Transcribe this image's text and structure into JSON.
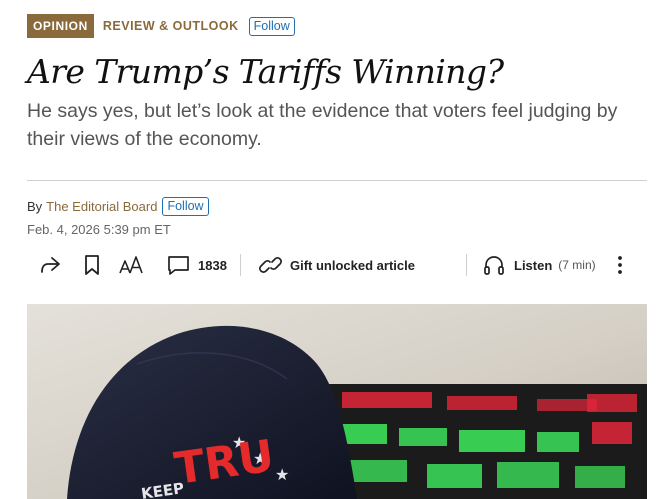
{
  "header": {
    "category_badge": "OPINION",
    "section": "REVIEW & OUTLOOK",
    "follow_label": "Follow"
  },
  "article": {
    "headline": "Are Trump’s Tariffs Winning?",
    "dek": "He says yes, but let’s look at the evidence that voters feel judging by their views of the economy.",
    "byline_prefix": "By",
    "author": "The Editorial Board",
    "author_follow_label": "Follow",
    "dateline": "Feb. 4, 2026 5:39 pm ET"
  },
  "toolbar": {
    "comment_count": "1838",
    "gift_label": "Gift unlocked article",
    "listen_label": "Listen",
    "listen_duration": "(7 min)",
    "icons": [
      "share-icon",
      "bookmark-icon",
      "text-size-icon",
      "comment-icon",
      "link-icon",
      "headphones-icon",
      "more-vertical-icon"
    ]
  },
  "hero_image": {
    "cap_text": "TRU",
    "cap_lower_text": "KEEP",
    "colors": {
      "cap": "#15192b",
      "cap_text": "#e42a2a",
      "ticker_green": "#3ce05a",
      "ticker_red": "#e3263a"
    }
  },
  "theme": {
    "accent": "#8a6a3b",
    "link_blue": "#1f6fb5"
  }
}
